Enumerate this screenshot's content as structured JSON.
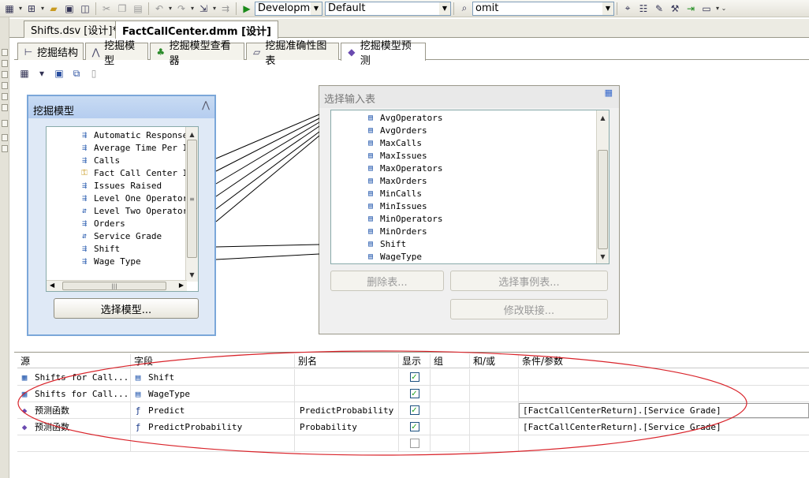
{
  "toolbar": {
    "config_combo": "Developmer",
    "platform_combo": "Default",
    "find_combo": "omit"
  },
  "doc_tabs": [
    {
      "label": "Shifts.dsv [设计]*",
      "active": false
    },
    {
      "label": "FactCallCenter.dmm [设计]",
      "active": true
    }
  ],
  "designer_tabs": [
    {
      "label": "挖掘结构",
      "icon": "structure-icon"
    },
    {
      "label": "挖掘模型",
      "icon": "model-icon"
    },
    {
      "label": "挖掘模型查看器",
      "icon": "viewer-icon"
    },
    {
      "label": "挖掘准确性图表",
      "icon": "chart-icon"
    },
    {
      "label": "挖掘模型预测",
      "icon": "diamond-icon",
      "active": true
    }
  ],
  "mining_model": {
    "title": "挖掘模型",
    "columns": [
      {
        "label": "Automatic Responses",
        "icon": "input-column-icon"
      },
      {
        "label": "Average Time Per Is",
        "icon": "input-column-icon"
      },
      {
        "label": "Calls",
        "icon": "input-column-icon"
      },
      {
        "label": "Fact Call Center ID",
        "icon": "key-icon"
      },
      {
        "label": "Issues Raised",
        "icon": "input-column-icon"
      },
      {
        "label": "Level One Operators",
        "icon": "input-column-icon"
      },
      {
        "label": "Level Two Operators",
        "icon": "predict-column-icon"
      },
      {
        "label": "Orders",
        "icon": "input-column-icon"
      },
      {
        "label": "Service Grade",
        "icon": "predict-column-icon"
      },
      {
        "label": "Shift",
        "icon": "input-column-icon"
      },
      {
        "label": "Wage Type",
        "icon": "input-column-icon"
      }
    ],
    "select_model_button": "选择模型..."
  },
  "input_table": {
    "title": "选择输入表",
    "columns": [
      "AvgOperators",
      "AvgOrders",
      "MaxCalls",
      "MaxIssues",
      "MaxOperators",
      "MaxOrders",
      "MinCalls",
      "MinIssues",
      "MinOperators",
      "MinOrders",
      "Shift",
      "WageType"
    ],
    "remove_table_button": "删除表...",
    "select_case_table_button": "选择事例表...",
    "modify_join_button": "修改联接..."
  },
  "grid": {
    "headers": {
      "source": "源",
      "field": "字段",
      "alias": "别名",
      "show": "显示",
      "group": "组",
      "and_or": "和/或",
      "criteria": "条件/参数"
    },
    "rows": [
      {
        "source": "Shifts for Call...",
        "source_icon": "table-icon",
        "field": "Shift",
        "field_icon": "column-icon",
        "alias": "",
        "show": true,
        "criteria": ""
      },
      {
        "source": "Shifts for Call...",
        "source_icon": "table-icon",
        "field": "WageType",
        "field_icon": "column-icon",
        "alias": "",
        "show": true,
        "criteria": ""
      },
      {
        "source": "预测函数",
        "source_icon": "prediction-function-icon",
        "field": "Predict",
        "field_icon": "function-icon",
        "alias": "PredictProbability",
        "show": true,
        "criteria": "[FactCallCenterReturn].[Service Grade]"
      },
      {
        "source": "预测函数",
        "source_icon": "prediction-function-icon",
        "field": "PredictProbability",
        "field_icon": "function-icon",
        "alias": "Probability",
        "show": true,
        "criteria": "[FactCallCenterReturn].[Service Grade]"
      },
      {
        "source": "",
        "field": "",
        "alias": "",
        "show": false,
        "criteria": ""
      }
    ]
  },
  "annotation_color": "#d9232a",
  "connector_color": "#000000"
}
